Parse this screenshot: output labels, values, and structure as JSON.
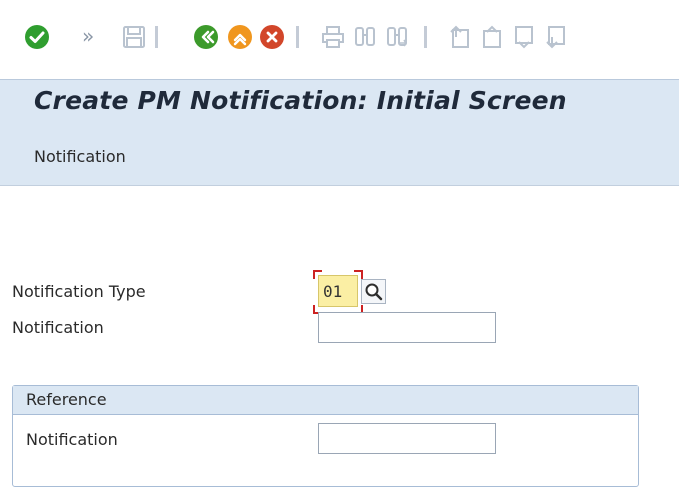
{
  "toolbar": {
    "icons": [
      "check-icon",
      "more-chevron-icon",
      "save-icon",
      "back-icon",
      "exit-icon",
      "cancel-icon",
      "print-icon",
      "find-icon",
      "find-next-icon",
      "first-page-icon",
      "previous-page-icon",
      "next-page-icon",
      "last-page-icon"
    ],
    "more_glyph": "»"
  },
  "title": "Create PM Notification: Initial Screen",
  "menu": {
    "notification_label": "Notification"
  },
  "form": {
    "notification_type_label": "Notification Type",
    "notification_type_value": "01",
    "notification_label": "Notification",
    "notification_value": ""
  },
  "reference": {
    "title": "Reference",
    "notification_label": "Notification",
    "notification_value": ""
  },
  "colors": {
    "accent_green": "#2f9e2f",
    "accent_orange": "#f0961e",
    "cancel_red": "#d2462a",
    "title_bg": "#dbe7f3",
    "required_bg": "#fbefa4"
  }
}
